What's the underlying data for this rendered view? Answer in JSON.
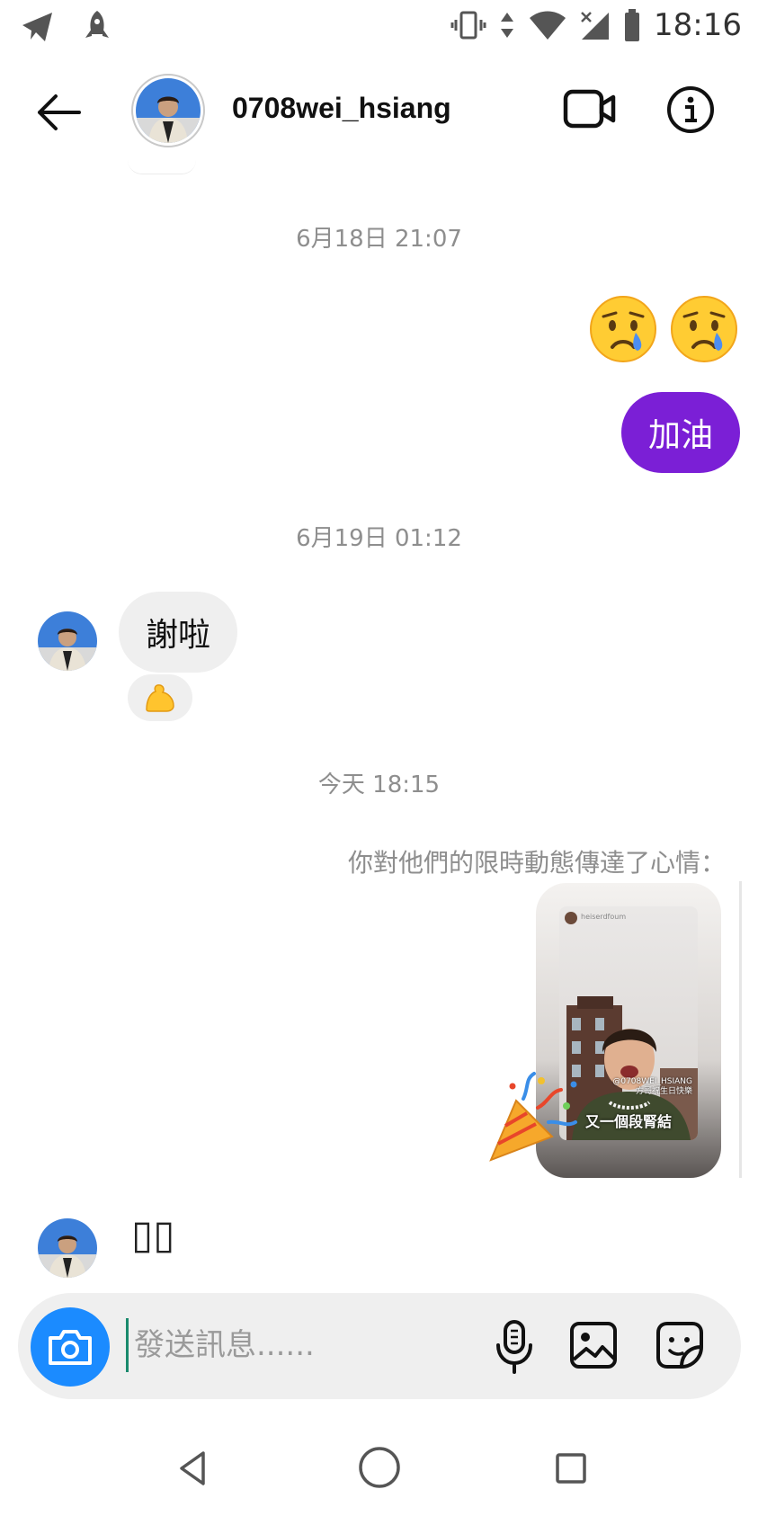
{
  "status_bar": {
    "time": "18:16",
    "icons": [
      "telegram-icon",
      "rocket-icon",
      "vibrate-icon",
      "data-arrows-icon",
      "wifi-icon",
      "no-signal-icon",
      "battery-icon"
    ]
  },
  "header": {
    "username": "0708wei_hsiang",
    "icons": [
      "back-arrow-icon",
      "video-call-icon",
      "info-icon"
    ]
  },
  "messages": {
    "timestamp_1": "6月18日 21:07",
    "sent_emoji": "😢😢",
    "sent_text": "加油",
    "timestamp_2": "6月19日 01:12",
    "received_text": "謝啦",
    "reaction_emoji": "💪",
    "timestamp_3": "今天 18:15",
    "story_caption": "你對他們的限時動態傳達了心情：",
    "story": {
      "account": "heiserdfoum",
      "tag_line_1": "@0708WEI_HSIANG",
      "tag_line_2": "方哥祝生日快樂",
      "overlay_text": "又一個段腎結"
    },
    "story_reaction_emoji": "🎉",
    "last_received_text": "▯▯"
  },
  "composer": {
    "placeholder": "發送訊息......",
    "value": "",
    "icons": [
      "camera-icon",
      "microphone-icon",
      "gallery-icon",
      "sticker-icon"
    ]
  },
  "colors": {
    "sent_bubble": "#7b1fd6",
    "received_bubble": "#efefef",
    "camera_button": "#1b8bff",
    "timestamp_text": "#8e8e8e"
  }
}
